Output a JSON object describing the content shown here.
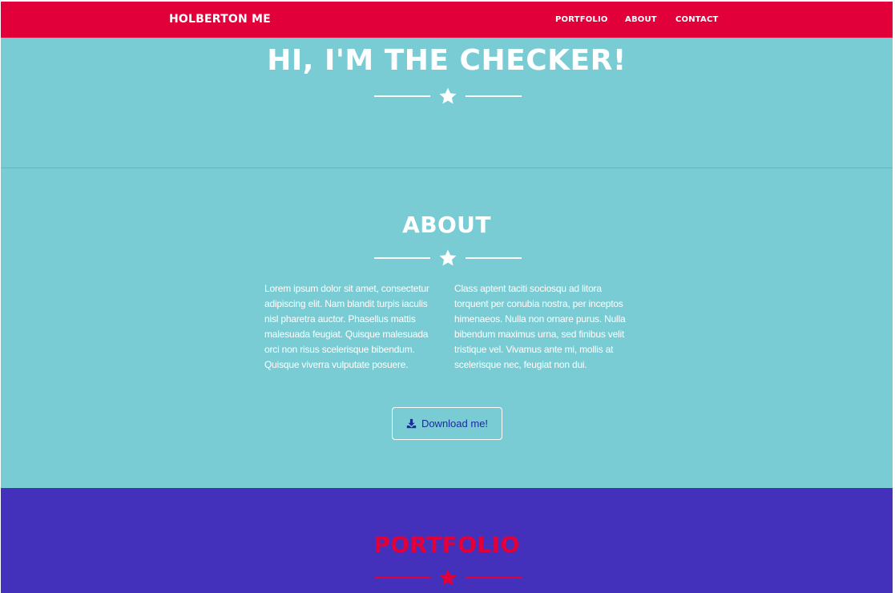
{
  "navbar": {
    "brand": "HOLBERTON ME",
    "links": {
      "portfolio": "PORTFOLIO",
      "about": "ABOUT",
      "contact": "CONTACT"
    }
  },
  "masthead": {
    "title": "HI, I'M THE CHECKER!"
  },
  "about": {
    "title": "ABOUT",
    "left_text": "Lorem ipsum dolor sit amet, consectetur adipiscing elit. Nam blandit turpis iaculis nisl pharetra auctor. Phasellus mattis malesuada feugiat. Quisque malesuada orci non risus scelerisque bibendum. Quisque viverra vulputate posuere.",
    "right_text": "Class aptent taciti sociosqu ad litora torquent per conubia nostra, per inceptos himenaeos. Nulla non ornare purus. Nulla bibendum maximus urna, sed finibus velit tristique vel. Vivamus ante mi, mollis at scelerisque nec, feugiat non dui.",
    "download_label": "Download me!"
  },
  "portfolio": {
    "title": "PORTFOLIO"
  },
  "colors": {
    "navbar": "#e2003b",
    "primary_bg": "#79ccd3",
    "portfolio_bg": "#4331bc",
    "accent": "#e2003b",
    "button_text": "#1b2b9c"
  },
  "icons": {
    "divider": "star-icon",
    "download": "download-icon"
  }
}
